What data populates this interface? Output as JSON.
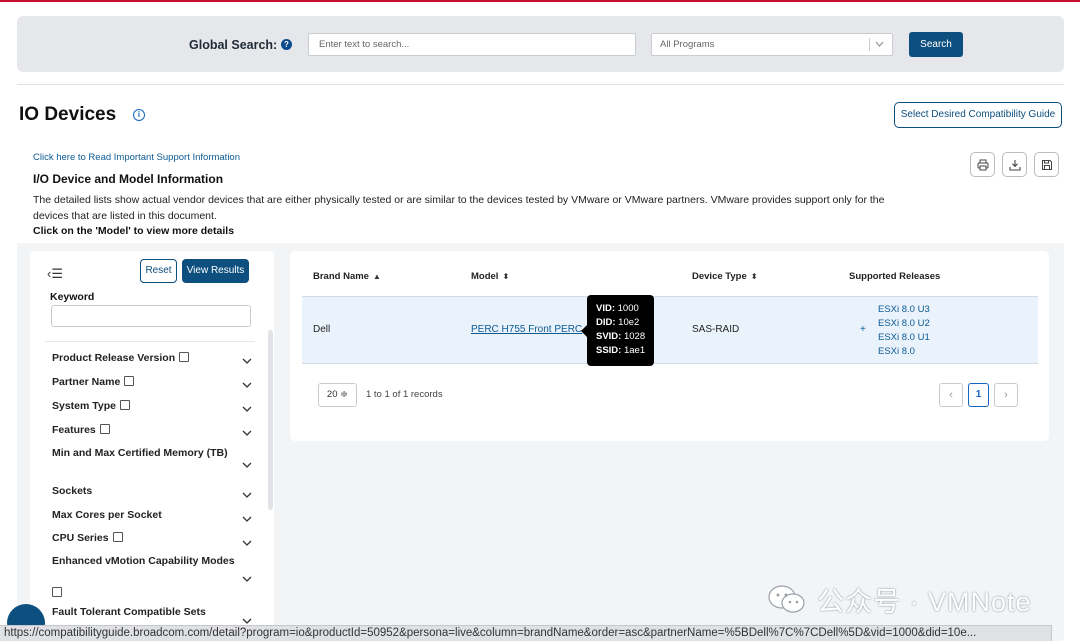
{
  "search": {
    "label": "Global Search:",
    "help_glyph": "?",
    "placeholder": "Enter text to search...",
    "program_select": "All Programs",
    "button": "Search"
  },
  "page": {
    "title": "IO Devices",
    "info_glyph": "i",
    "guide_button": "Select Desired Compatibility Guide"
  },
  "info": {
    "support_link": "Click here to Read Important Support Information",
    "section_title": "I/O Device and Model Information",
    "description": "The detailed lists show actual vendor devices that are either physically tested or are similar to the devices tested by VMware or VMware partners. VMware provides support only for the devices that are listed in this document.",
    "click_note": "Click on the 'Model' to view more details"
  },
  "toolbar": {
    "print_icon": "print-icon",
    "download_icon": "download-icon",
    "save_icon": "save-icon"
  },
  "filters": {
    "collapse_glyph": "‹☰",
    "reset": "Reset",
    "view_results": "View Results",
    "keyword_label": "Keyword",
    "items": [
      {
        "label": "Product Release Version"
      },
      {
        "label": "Partner Name"
      },
      {
        "label": "System Type"
      },
      {
        "label": "Features"
      },
      {
        "label": "Min and Max Certified Memory (TB)"
      },
      {
        "label": "Sockets"
      },
      {
        "label": "Max Cores per Socket"
      },
      {
        "label": "CPU Series"
      },
      {
        "label": "Enhanced vMotion Capability Modes"
      },
      {
        "label": "Fault Tolerant Compatible Sets"
      }
    ]
  },
  "table": {
    "columns": [
      {
        "label": "Brand Name",
        "sort": "▲"
      },
      {
        "label": "Model",
        "sort": "⬍"
      },
      {
        "label": "Device Type",
        "sort": "⬍"
      },
      {
        "label": "Supported Releases",
        "sort": ""
      }
    ],
    "rows": [
      {
        "brand": "Dell",
        "model": "PERC H755 Front PERC",
        "device_type": "SAS-RAID",
        "expand": "+",
        "releases": [
          "ESXi 8.0 U3",
          "ESXi 8.0 U2",
          "ESXi 8.0 U1",
          "ESXi 8.0"
        ]
      }
    ]
  },
  "tooltip": {
    "vid_label": "VID:",
    "vid": "1000",
    "did_label": "DID:",
    "did": "10e2",
    "svid_label": "SVID:",
    "svid": "1028",
    "ssid_label": "SSID:",
    "ssid": "1ae1"
  },
  "pagination": {
    "page_size": "20 ≑",
    "records": "1 to 1 of 1 records",
    "prev": "‹",
    "current": "1",
    "next": "›"
  },
  "watermark": "公众号 · VMNote",
  "status_url": "https://compatibilityguide.broadcom.com/detail?program=io&productId=50952&persona=live&column=brandName&order=asc&partnerName=%5BDell%7C%7CDell%5D&vid=1000&did=10e..."
}
